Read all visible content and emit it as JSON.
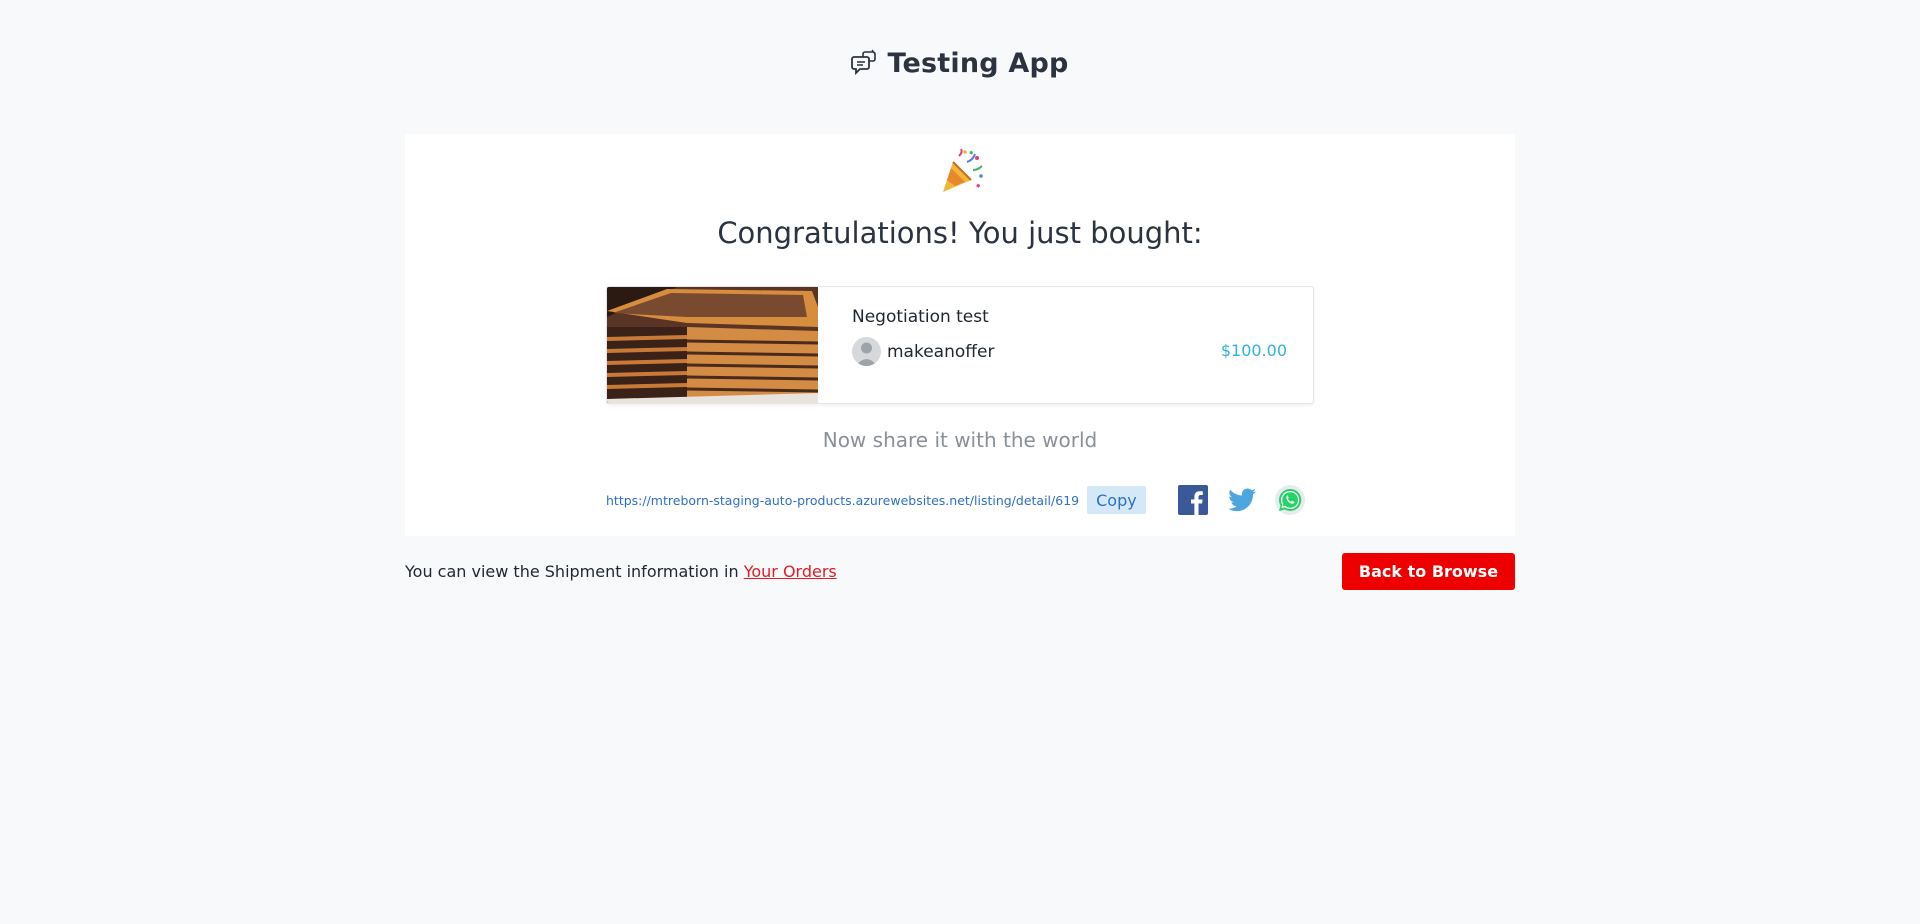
{
  "header": {
    "app_title": "Testing App",
    "logo_icon": "chat-bubbles-icon"
  },
  "confirmation": {
    "celebration_icon": "party-popper-icon",
    "heading": "Congratulations! You just bought:"
  },
  "product": {
    "name": "Negotiation test",
    "seller": "makeanoffer",
    "price": "$100.00",
    "image_icon": "layered-cake-image"
  },
  "share": {
    "prompt": "Now share it with the world",
    "url": "https://mtreborn-staging-auto-products.azurewebsites.net/listing/detail/619",
    "copy_label": "Copy",
    "networks": [
      "facebook-icon",
      "twitter-icon",
      "whatsapp-icon"
    ]
  },
  "footer": {
    "shipment_text": "You can view the Shipment information in ",
    "orders_link": "Your Orders",
    "back_button": "Back to Browse"
  },
  "colors": {
    "accent_red": "#ee0000",
    "price_blue": "#2eb4d8",
    "link_blue": "#2d6fc7",
    "background": "#f8f9fb"
  }
}
